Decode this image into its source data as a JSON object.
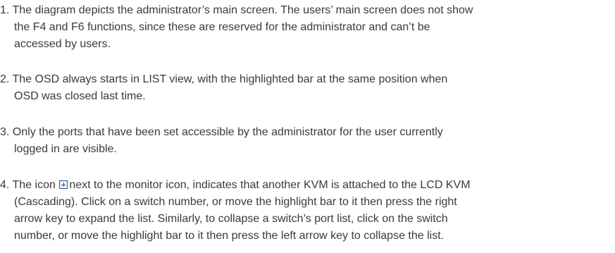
{
  "notes": [
    {
      "number": "1.",
      "lines": [
        "The diagram depicts the administrator’s main screen. The users’ main screen does not show",
        "the F4 and F6 functions, since these are reserved for the administrator and can’t be",
        "accessed by users."
      ]
    },
    {
      "number": "2.",
      "lines": [
        "The OSD always starts in LIST view, with the highlighted bar at the same position when",
        "OSD was closed last time."
      ]
    },
    {
      "number": "3.",
      "lines": [
        "Only the ports that have been set accessible by the administrator for the user currently",
        "logged in are visible."
      ]
    },
    {
      "number": "4.",
      "line1_before_icon": "The icon",
      "icon": "expand-plus-icon",
      "line1_after_icon": "next to the monitor icon, indicates that another KVM is attached to the LCD KVM",
      "lines": [
        "(Cascading). Click on a switch number, or move the highlight bar to it then press the right",
        "arrow key to expand the list. Similarly, to collapse a switch’s port list, click on the switch",
        "number, or move the highlight bar to it then press the left arrow key to collapse the list."
      ]
    }
  ]
}
